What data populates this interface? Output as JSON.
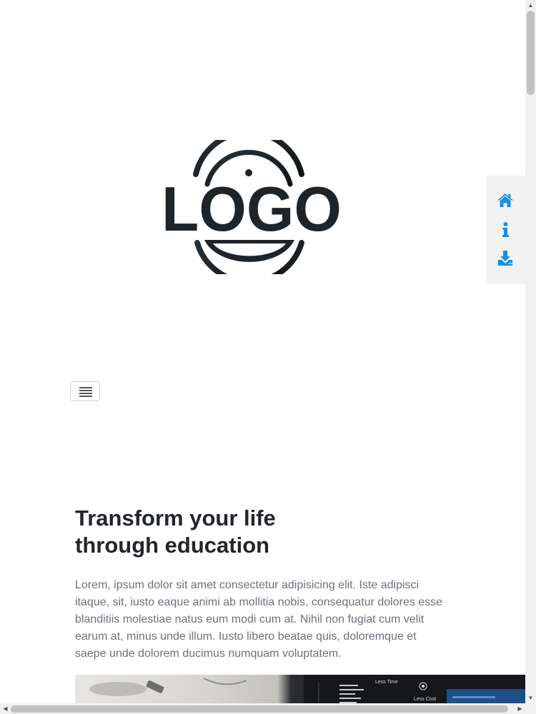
{
  "logo": {
    "text": "LOGO",
    "color": "#1e2428"
  },
  "side_nav": {
    "accent_color": "#1a8fe0",
    "items": [
      {
        "icon": "home-icon",
        "label": "Home"
      },
      {
        "icon": "info-icon",
        "label": "Info"
      },
      {
        "icon": "download-icon",
        "label": "Download"
      }
    ]
  },
  "menu_toggle": {
    "icon": "hamburger-icon"
  },
  "hero": {
    "title": "Transform your life through education",
    "text": "Lorem, ipsum dolor sit amet consectetur adipisicing elit. Iste adipisci itaque, sit, iusto eaque animi ab mollitia nobis, consequatur dolores esse blanditiis molestiae natus eum modi cum at. Nihil non fugiat cum velit earum at, minus unde illum. Iusto libero beatae quis, doloremque et saepe unde dolorem ducimus numquam voluptatem."
  },
  "hero_image": {
    "subject": "desk with notebook and laptop",
    "screen_labels": [
      "Less Time",
      "Less Cost"
    ]
  },
  "scrollbars": {
    "vertical": "▲▼",
    "horizontal": "◀▶"
  }
}
